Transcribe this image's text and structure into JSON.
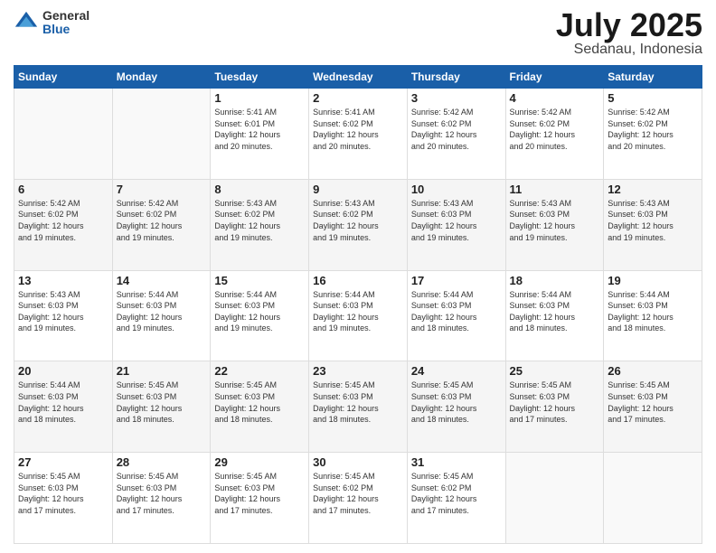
{
  "logo": {
    "general": "General",
    "blue": "Blue"
  },
  "title": "July 2025",
  "location": "Sedanau, Indonesia",
  "days_of_week": [
    "Sunday",
    "Monday",
    "Tuesday",
    "Wednesday",
    "Thursday",
    "Friday",
    "Saturday"
  ],
  "weeks": [
    [
      {
        "day": "",
        "info": ""
      },
      {
        "day": "",
        "info": ""
      },
      {
        "day": "1",
        "info": "Sunrise: 5:41 AM\nSunset: 6:01 PM\nDaylight: 12 hours\nand 20 minutes."
      },
      {
        "day": "2",
        "info": "Sunrise: 5:41 AM\nSunset: 6:02 PM\nDaylight: 12 hours\nand 20 minutes."
      },
      {
        "day": "3",
        "info": "Sunrise: 5:42 AM\nSunset: 6:02 PM\nDaylight: 12 hours\nand 20 minutes."
      },
      {
        "day": "4",
        "info": "Sunrise: 5:42 AM\nSunset: 6:02 PM\nDaylight: 12 hours\nand 20 minutes."
      },
      {
        "day": "5",
        "info": "Sunrise: 5:42 AM\nSunset: 6:02 PM\nDaylight: 12 hours\nand 20 minutes."
      }
    ],
    [
      {
        "day": "6",
        "info": "Sunrise: 5:42 AM\nSunset: 6:02 PM\nDaylight: 12 hours\nand 19 minutes."
      },
      {
        "day": "7",
        "info": "Sunrise: 5:42 AM\nSunset: 6:02 PM\nDaylight: 12 hours\nand 19 minutes."
      },
      {
        "day": "8",
        "info": "Sunrise: 5:43 AM\nSunset: 6:02 PM\nDaylight: 12 hours\nand 19 minutes."
      },
      {
        "day": "9",
        "info": "Sunrise: 5:43 AM\nSunset: 6:02 PM\nDaylight: 12 hours\nand 19 minutes."
      },
      {
        "day": "10",
        "info": "Sunrise: 5:43 AM\nSunset: 6:03 PM\nDaylight: 12 hours\nand 19 minutes."
      },
      {
        "day": "11",
        "info": "Sunrise: 5:43 AM\nSunset: 6:03 PM\nDaylight: 12 hours\nand 19 minutes."
      },
      {
        "day": "12",
        "info": "Sunrise: 5:43 AM\nSunset: 6:03 PM\nDaylight: 12 hours\nand 19 minutes."
      }
    ],
    [
      {
        "day": "13",
        "info": "Sunrise: 5:43 AM\nSunset: 6:03 PM\nDaylight: 12 hours\nand 19 minutes."
      },
      {
        "day": "14",
        "info": "Sunrise: 5:44 AM\nSunset: 6:03 PM\nDaylight: 12 hours\nand 19 minutes."
      },
      {
        "day": "15",
        "info": "Sunrise: 5:44 AM\nSunset: 6:03 PM\nDaylight: 12 hours\nand 19 minutes."
      },
      {
        "day": "16",
        "info": "Sunrise: 5:44 AM\nSunset: 6:03 PM\nDaylight: 12 hours\nand 19 minutes."
      },
      {
        "day": "17",
        "info": "Sunrise: 5:44 AM\nSunset: 6:03 PM\nDaylight: 12 hours\nand 18 minutes."
      },
      {
        "day": "18",
        "info": "Sunrise: 5:44 AM\nSunset: 6:03 PM\nDaylight: 12 hours\nand 18 minutes."
      },
      {
        "day": "19",
        "info": "Sunrise: 5:44 AM\nSunset: 6:03 PM\nDaylight: 12 hours\nand 18 minutes."
      }
    ],
    [
      {
        "day": "20",
        "info": "Sunrise: 5:44 AM\nSunset: 6:03 PM\nDaylight: 12 hours\nand 18 minutes."
      },
      {
        "day": "21",
        "info": "Sunrise: 5:45 AM\nSunset: 6:03 PM\nDaylight: 12 hours\nand 18 minutes."
      },
      {
        "day": "22",
        "info": "Sunrise: 5:45 AM\nSunset: 6:03 PM\nDaylight: 12 hours\nand 18 minutes."
      },
      {
        "day": "23",
        "info": "Sunrise: 5:45 AM\nSunset: 6:03 PM\nDaylight: 12 hours\nand 18 minutes."
      },
      {
        "day": "24",
        "info": "Sunrise: 5:45 AM\nSunset: 6:03 PM\nDaylight: 12 hours\nand 18 minutes."
      },
      {
        "day": "25",
        "info": "Sunrise: 5:45 AM\nSunset: 6:03 PM\nDaylight: 12 hours\nand 17 minutes."
      },
      {
        "day": "26",
        "info": "Sunrise: 5:45 AM\nSunset: 6:03 PM\nDaylight: 12 hours\nand 17 minutes."
      }
    ],
    [
      {
        "day": "27",
        "info": "Sunrise: 5:45 AM\nSunset: 6:03 PM\nDaylight: 12 hours\nand 17 minutes."
      },
      {
        "day": "28",
        "info": "Sunrise: 5:45 AM\nSunset: 6:03 PM\nDaylight: 12 hours\nand 17 minutes."
      },
      {
        "day": "29",
        "info": "Sunrise: 5:45 AM\nSunset: 6:03 PM\nDaylight: 12 hours\nand 17 minutes."
      },
      {
        "day": "30",
        "info": "Sunrise: 5:45 AM\nSunset: 6:02 PM\nDaylight: 12 hours\nand 17 minutes."
      },
      {
        "day": "31",
        "info": "Sunrise: 5:45 AM\nSunset: 6:02 PM\nDaylight: 12 hours\nand 17 minutes."
      },
      {
        "day": "",
        "info": ""
      },
      {
        "day": "",
        "info": ""
      }
    ]
  ]
}
